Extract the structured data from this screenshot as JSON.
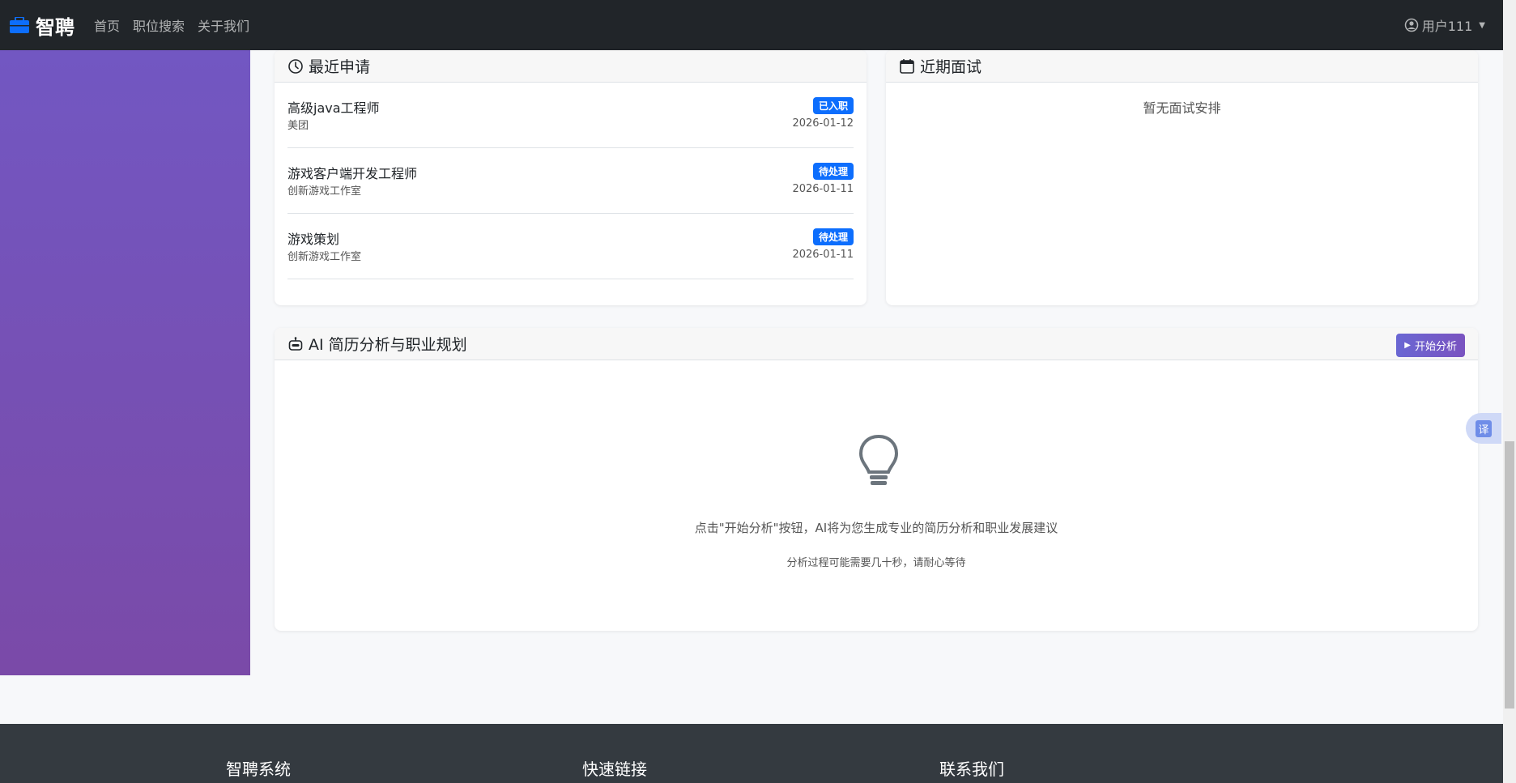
{
  "navbar": {
    "brand": "智聘",
    "links": [
      "首页",
      "职位搜索",
      "关于我们"
    ],
    "user": "用户111"
  },
  "recent_applications": {
    "title": "最近申请",
    "items": [
      {
        "title": "高级java工程师",
        "company": "美团",
        "status": "已入职",
        "date": "2026-01-12"
      },
      {
        "title": "游戏客户端开发工程师",
        "company": "创新游戏工作室",
        "status": "待处理",
        "date": "2026-01-11"
      },
      {
        "title": "游戏策划",
        "company": "创新游戏工作室",
        "status": "待处理",
        "date": "2026-01-11"
      }
    ]
  },
  "upcoming_interviews": {
    "title": "近期面试",
    "empty": "暂无面试安排"
  },
  "ai_analysis": {
    "title": "AI 简历分析与职业规划",
    "button": "开始分析",
    "hint": "点击\"开始分析\"按钮，AI将为您生成专业的简历分析和职业发展建议",
    "sub_hint": "分析过程可能需要几十秒，请耐心等待"
  },
  "translate_label": "译",
  "footer": {
    "headings": [
      "智聘系统",
      "快速链接",
      "联系我们"
    ]
  },
  "colors": {
    "navbar_bg": "#212529",
    "accent": "#0d6efd",
    "sidebar_gradient_start": "#7257c2",
    "sidebar_gradient_end": "#7a4aa8",
    "footer_bg": "#343a40"
  }
}
